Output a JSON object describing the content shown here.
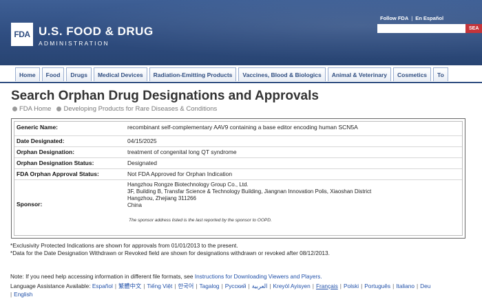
{
  "header": {
    "logo_text": "FDA",
    "agency_line1": "U.S. FOOD & DRUG",
    "agency_line2": "ADMINISTRATION",
    "top_links": [
      "Follow FDA",
      "En Español"
    ],
    "search_button": "SEA",
    "colors": {
      "header_bg": "#2f4d80",
      "search_button": "#c1272d",
      "link": "#1f4fa8"
    }
  },
  "nav": {
    "tabs": [
      "Home",
      "Food",
      "Drugs",
      "Medical Devices",
      "Radiation-Emitting Products",
      "Vaccines, Blood & Biologics",
      "Animal & Veterinary",
      "Cosmetics",
      "To"
    ]
  },
  "page": {
    "title": "Search Orphan Drug Designations and Approvals",
    "breadcrumb": [
      "FDA Home",
      "Developing Products for Rare Diseases & Conditions"
    ]
  },
  "record": {
    "generic_name_label": "Generic Name:",
    "generic_name": "recombinant self-complementary AAV9 containing a base editor encoding human SCN5A",
    "date_designated_label": "Date Designated:",
    "date_designated": "04/15/2025",
    "orphan_designation_label": "Orphan Designation:",
    "orphan_designation": "treatment of congenital long QT syndrome",
    "designation_status_label": "Orphan Designation Status:",
    "designation_status": "Designated",
    "approval_status_label": "FDA Orphan Approval Status:",
    "approval_status": "Not FDA Approved for Orphan Indication",
    "sponsor_label": "Sponsor:",
    "sponsor_lines": [
      "Hangzhou Rongze Biotechnology Group Co., Ltd.",
      "3F, Building B, Transfar Science & Technology Building, Jiangnan Innovation Polis, Xiaoshan District",
      "Hangzhou, Zhejiang 311266",
      "China"
    ],
    "sponsor_note": "The sponsor address listed is the last reported by the sponsor to OOPD."
  },
  "notes": [
    "*Exclusivity Protected Indications are shown for approvals from 01/01/2013 to the present.",
    "*Data for the Date Designation Withdrawn or Revoked field are shown for designations withdrawn or revoked after 08/12/2013."
  ],
  "help": {
    "prefix": "Note: If you need help accessing information in different file formats, see ",
    "link": "Instructions for Downloading Viewers and Players."
  },
  "language": {
    "label": "Language Assistance Available: ",
    "items": [
      "Español",
      "繁體中文",
      "Tiếng Việt",
      "한국어",
      "Tagalog",
      "Русский",
      "العربية",
      "Kreyòl Ayisyen",
      "Français",
      "Polski",
      "Português",
      "Italiano",
      "Deu"
    ],
    "second_line": "English"
  }
}
